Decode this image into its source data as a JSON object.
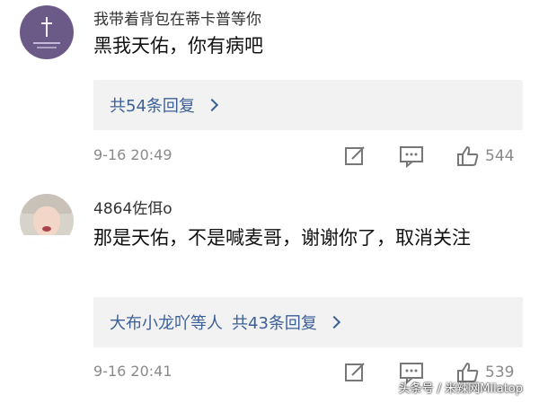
{
  "comments": [
    {
      "username": "我带着背包在蒂卡普等你",
      "text": "黑我天佑，你有病吧",
      "reply_prefix": "",
      "reply_summary": "共54条回复",
      "time": "9-16 20:49",
      "likes": "544"
    },
    {
      "username": "4864佐佴o",
      "text": "那是天佑，不是喊麦哥，谢谢你了，取消关注",
      "reply_prefix": "大布小龙吖等人",
      "reply_summary": "共43条回复",
      "time": "9-16 20:41",
      "likes": "539"
    }
  ],
  "watermark": "头条号 / 米辣网Milatop",
  "icons": {
    "edit": "edit-icon",
    "comment": "comment-icon",
    "like": "thumbs-up-icon",
    "chevron": "chevron-right-icon"
  },
  "colors": {
    "link": "#3b5f97",
    "muted": "#8a8a8a",
    "reply_bg": "#f2f2f2"
  }
}
